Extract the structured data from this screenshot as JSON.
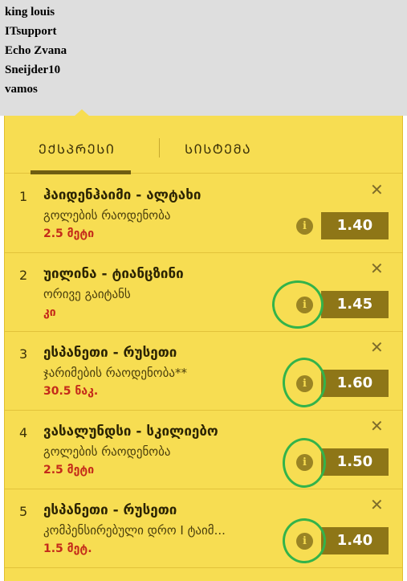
{
  "users": [
    "king louis",
    "ITsupport",
    "Echo Zvana",
    "Sneijder10",
    "vamos"
  ],
  "tabs": {
    "express": "ᲔᲥᲡᲞᲠᲔᲡᲘ",
    "system": "ᲡᲘᲡᲢᲔᲛᲐ"
  },
  "bets": [
    {
      "num": "1",
      "title": "ჰაიდენჰაიმი - ალტახი",
      "market": "გოლების რაოდენობა",
      "pick": "2.5 მეტი",
      "odds": "1.40"
    },
    {
      "num": "2",
      "title": "უილინა - ტიანცზინი",
      "market": "ორივე გაიტანს",
      "pick": "კი",
      "odds": "1.45"
    },
    {
      "num": "3",
      "title": "ესპანეთი - რუსეთი",
      "market": "ჯარიმების რაოდენობა**",
      "pick": "30.5 ნაკ.",
      "odds": "1.60"
    },
    {
      "num": "4",
      "title": "ვასალუნდსი - სკილიებო",
      "market": "გოლების რაოდენობა",
      "pick": "2.5 მეტი",
      "odds": "1.50"
    },
    {
      "num": "5",
      "title": "ესპანეთი - რუსეთი",
      "market": "კომპენსირებული დრო I ტაიმ...",
      "pick": "1.5 მეტ.",
      "odds": "1.40"
    }
  ],
  "colors": {
    "panel": "#f7dd52",
    "odds_bg": "#8e7617",
    "pick_red": "#c42a1a",
    "highlight_ring": "#33b34a"
  }
}
